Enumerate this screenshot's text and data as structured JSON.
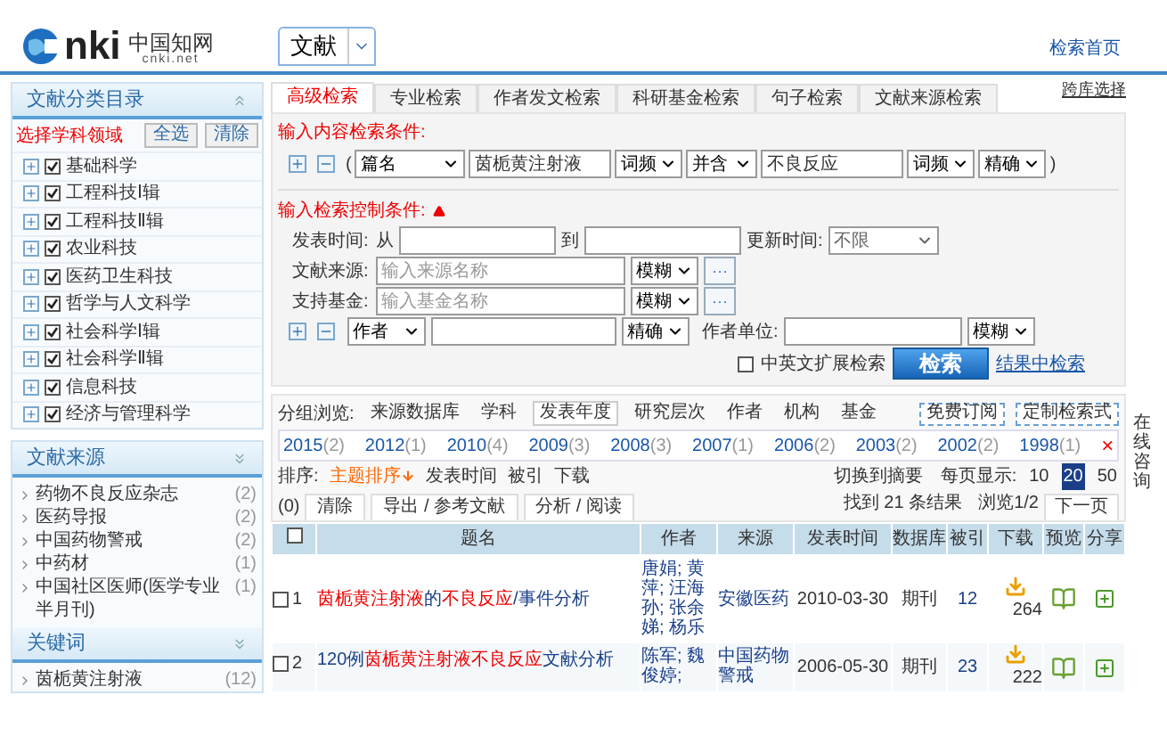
{
  "header": {
    "logo": {
      "mark": "nki",
      "chinese": "中国知网",
      "domain": "cnki.net"
    },
    "db_select": "文献",
    "home_link": "检索首页"
  },
  "sidebar": {
    "category_panel": {
      "title": "文献分类目录",
      "select_label": "选择学科领域",
      "buttons": [
        "全选",
        "清除"
      ],
      "categories": [
        {
          "label": "基础科学",
          "checked": true
        },
        {
          "label": "工程科技Ⅰ辑",
          "checked": true
        },
        {
          "label": "工程科技Ⅱ辑",
          "checked": true
        },
        {
          "label": "农业科技",
          "checked": true
        },
        {
          "label": "医药卫生科技",
          "checked": true
        },
        {
          "label": "哲学与人文科学",
          "checked": true
        },
        {
          "label": "社会科学Ⅰ辑",
          "checked": true
        },
        {
          "label": "社会科学Ⅱ辑",
          "checked": true
        },
        {
          "label": "信息科技",
          "checked": true
        },
        {
          "label": "经济与管理科学",
          "checked": true
        }
      ]
    },
    "source_panel": {
      "title": "文献来源",
      "items": [
        {
          "label": "药物不良反应杂志",
          "count": "(2)"
        },
        {
          "label": "医药导报",
          "count": "(2)"
        },
        {
          "label": "中国药物警戒",
          "count": "(2)"
        },
        {
          "label": "中药材",
          "count": "(1)"
        },
        {
          "label": "中国社区医师(医学专业半月刊)",
          "count": "(1)"
        }
      ]
    },
    "keyword_panel": {
      "title": "关键词",
      "items": [
        {
          "label": "茵栀黄注射液",
          "count": "(12)"
        }
      ]
    }
  },
  "search_tabs": [
    {
      "label": "高级检索",
      "selected": true
    },
    {
      "label": "专业检索",
      "selected": false
    },
    {
      "label": "作者发文检索",
      "selected": false
    },
    {
      "label": "科研基金检索",
      "selected": false
    },
    {
      "label": "句子检索",
      "selected": false
    },
    {
      "label": "文献来源检索",
      "selected": false
    }
  ],
  "cross_db_link": "跨库选择",
  "content_conditions": {
    "title": "输入内容检索条件:",
    "open_paren": "(",
    "field": "篇名",
    "term1": "茵栀黄注射液",
    "freq1": "词频",
    "relation": "并含",
    "term2": "不良反应",
    "freq2": "词频",
    "match": "精确",
    "close_paren": ")"
  },
  "control_conditions": {
    "title": "输入检索控制条件:",
    "date": {
      "label": "发表时间:",
      "from": "从",
      "to": "到",
      "update_label": "更新时间:",
      "update_value": "不限"
    },
    "source": {
      "label": "文献来源:",
      "placeholder": "输入来源名称",
      "match": "模糊",
      "more": "···"
    },
    "fund": {
      "label": "支持基金:",
      "placeholder": "输入基金名称",
      "match": "模糊",
      "more": "···"
    },
    "author": {
      "field": "作者",
      "match": "精确",
      "org_label": "作者单位:",
      "org_match": "模糊"
    },
    "extended": {
      "label": "中英文扩展检索",
      "checked": false
    },
    "search_button": "检索",
    "within_link": "结果中检索"
  },
  "group_browse": {
    "label": "分组浏览:",
    "tabs": [
      {
        "label": "来源数据库",
        "selected": false
      },
      {
        "label": "学科",
        "selected": false
      },
      {
        "label": "发表年度",
        "selected": true
      },
      {
        "label": "研究层次",
        "selected": false
      },
      {
        "label": "作者",
        "selected": false
      },
      {
        "label": "机构",
        "selected": false
      },
      {
        "label": "基金",
        "selected": false
      }
    ],
    "buttons": [
      "免费订阅",
      "定制检索式"
    ],
    "years": [
      {
        "year": "2015",
        "count": "(2)"
      },
      {
        "year": "2012",
        "count": "(1)"
      },
      {
        "year": "2010",
        "count": "(4)"
      },
      {
        "year": "2009",
        "count": "(3)"
      },
      {
        "year": "2008",
        "count": "(3)"
      },
      {
        "year": "2007",
        "count": "(1)"
      },
      {
        "year": "2006",
        "count": "(2)"
      },
      {
        "year": "2003",
        "count": "(2)"
      },
      {
        "year": "2002",
        "count": "(2)"
      },
      {
        "year": "1998",
        "count": "(1)"
      }
    ],
    "close": "×"
  },
  "sort": {
    "label": "排序:",
    "items": [
      {
        "label": "主题排序",
        "selected": true
      },
      {
        "label": "发表时间",
        "selected": false
      },
      {
        "label": "被引",
        "selected": false
      },
      {
        "label": "下载",
        "selected": false
      }
    ],
    "abstract_link": "切换到摘要",
    "page_size_label": "每页显示:",
    "page_sizes": [
      {
        "label": "10",
        "selected": false
      },
      {
        "label": "20",
        "selected": true
      },
      {
        "label": "50",
        "selected": false
      }
    ]
  },
  "actions": {
    "count": "(0)",
    "buttons": [
      "清除",
      "导出 / 参考文献",
      "分析 / 阅读"
    ],
    "found": "找到 21 条结果",
    "page": "浏览1/2",
    "next": "下一页"
  },
  "online_help": "在线咨询",
  "table": {
    "select_all_checked": false,
    "columns": [
      "题名",
      "作者",
      "来源",
      "发表时间",
      "数据库",
      "被引",
      "下载",
      "预览",
      "分享"
    ],
    "rows": [
      {
        "index": "1",
        "checked": false,
        "title": [
          {
            "text": "茵栀黄注射液",
            "highlight": true
          },
          {
            "text": "的",
            "highlight": false
          },
          {
            "text": "不良反应",
            "highlight": true
          },
          {
            "text": "/事件分析",
            "highlight": false
          }
        ],
        "authors": "唐娟; 黄萍; 汪海孙; 张余娣; 杨乐",
        "source": "安徽医药",
        "date": "2010-03-30",
        "database": "期刊",
        "cited": "12",
        "downloads": "264"
      },
      {
        "index": "2",
        "checked": false,
        "title": [
          {
            "text": "120例",
            "highlight": false
          },
          {
            "text": "茵栀黄注射液不良反应",
            "highlight": true
          },
          {
            "text": "文献分析",
            "highlight": false
          }
        ],
        "authors": "陈军; 魏俊婷;",
        "source": "中国药物警戒",
        "date": "2006-05-30",
        "database": "期刊",
        "cited": "23",
        "downloads": "222"
      }
    ]
  }
}
